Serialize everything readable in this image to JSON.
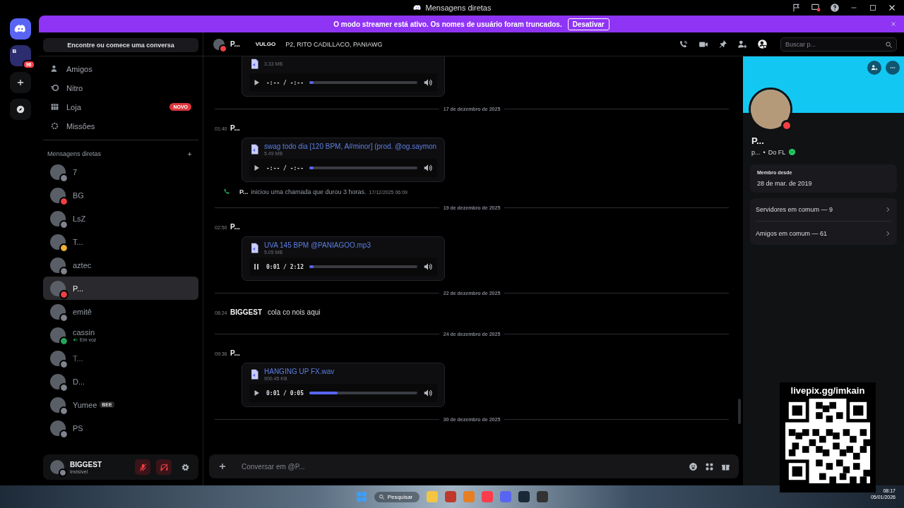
{
  "window": {
    "title": "Mensagens diretas"
  },
  "servers": {
    "folder_letter": "B",
    "badge": "96"
  },
  "banner": {
    "text": "O modo streamer está ativo. Os nomes de usuário foram truncados.",
    "button": "Desativar"
  },
  "sidebar": {
    "search_button": "Encontre ou comece uma conversa",
    "nav": [
      {
        "kind": "friends",
        "label": "Amigos"
      },
      {
        "kind": "nitro",
        "label": "Nitro"
      },
      {
        "kind": "shop",
        "label": "Loja",
        "badge": "NOVO"
      },
      {
        "kind": "quests",
        "label": "Missões"
      }
    ],
    "dm_header": "Mensagens diretas",
    "dms": [
      {
        "name": "7",
        "color": "#80848e",
        "selected": false
      },
      {
        "name": "BG",
        "color": "#f23f43",
        "selected": false
      },
      {
        "name": "LsZ",
        "color": "#80848e",
        "selected": false
      },
      {
        "name": "T...",
        "color": "#f0b232",
        "selected": false
      },
      {
        "name": "aztec",
        "color": "#80848e",
        "selected": false
      },
      {
        "name": "P...",
        "color": "#f23f43",
        "selected": true
      },
      {
        "name": "emitê",
        "color": "#80848e",
        "selected": false
      },
      {
        "name": "cassin",
        "color": "#23a55a",
        "activity": "Em voz",
        "selected": false
      },
      {
        "name": "T...",
        "color": "#80848e",
        "dimmed": true,
        "selected": false
      },
      {
        "name": "D...",
        "color": "#80848e",
        "selected": false
      },
      {
        "name": "Yumee",
        "color": "#80848e",
        "tag": "BEE",
        "selected": false
      },
      {
        "name": "PS",
        "color": "#80848e",
        "selected": false
      }
    ],
    "user": {
      "name": "BIGGEST",
      "status_text": "Invisível",
      "color": "#80848e",
      "muted": true,
      "deafened": true
    }
  },
  "chat": {
    "recipient": {
      "name": "P...",
      "color": "#f23f43"
    },
    "alias_label": "VULGO",
    "aliases": "P2, RITO CADILLACO, PANIAWG",
    "search_placeholder": "Buscar p...",
    "items": [
      {
        "kind": "attachment",
        "size": "3.33 MB",
        "time": "-:-- / -:--",
        "playing": false,
        "level": 0.02
      },
      {
        "kind": "divider",
        "date": "17 de dezembro de 2025"
      },
      {
        "kind": "message",
        "time": "01:40",
        "author": "P...",
        "attachment": {
          "name": "swag todo dia [120 BPM, A#minor] (prod. @og.saymon",
          "size": "5.49 MB",
          "time": "-:-- / -:--",
          "playing": false,
          "level": 0.02
        }
      },
      {
        "kind": "call",
        "author": "P...",
        "text": "iniciou uma chamada que durou 3 horas.",
        "timestamp": "17/12/2025 06:09"
      },
      {
        "kind": "divider",
        "date": "19 de dezembro de 2025"
      },
      {
        "kind": "message",
        "time": "02:50",
        "author": "P...",
        "attachment": {
          "name": "UVA 145 BPM @PANIAGOO.mp3",
          "size": "5.05 MB",
          "time": "0:01 / 2:12",
          "playing": true,
          "level": 0.01
        }
      },
      {
        "kind": "divider",
        "date": "22 de dezembro de 2025"
      },
      {
        "kind": "message",
        "time": "08:24",
        "author": "BIGGEST",
        "text": "cola co nois aqui"
      },
      {
        "kind": "divider",
        "date": "24 de dezembro de 2025"
      },
      {
        "kind": "message",
        "time": "09:36",
        "author": "P...",
        "attachment": {
          "name": "HANGING UP FX.wav",
          "size": "900.45 KB",
          "time": "0:01 / 0:05",
          "playing": false,
          "level": 0.26
        }
      },
      {
        "kind": "divider",
        "date": "30 de dezembro de 2025"
      }
    ],
    "composer_placeholder": "Conversar em @P..."
  },
  "profile": {
    "name": "P...",
    "username": "p...",
    "separator": "•",
    "pronoun_note": "Do FL",
    "color": "#f23f43",
    "member_since_label": "Membro desde",
    "member_since": "28 de mar. de 2019",
    "rows": [
      "Servidores em comum — 9",
      "Amigos em comum — 61"
    ]
  },
  "taskbar": {
    "search": "Pesquisar",
    "time": "08:17",
    "date": "05/01/2026"
  },
  "overlay": {
    "url": "livepix.gg/imkain"
  }
}
